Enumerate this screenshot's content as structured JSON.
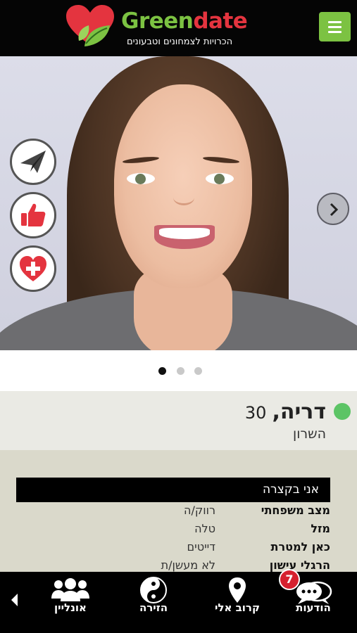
{
  "header": {
    "brand_part1": "Green",
    "brand_part2": "date",
    "tagline": "הכרויות לצמחונים וטבעונים",
    "menu_icon": "hamburger-icon"
  },
  "photo": {
    "actions": [
      {
        "icon": "paper-plane-icon"
      },
      {
        "icon": "thumbs-up-icon"
      },
      {
        "icon": "heart-plus-icon"
      }
    ],
    "next_icon": "chevron-right-icon",
    "dots_total": 3,
    "dots_active": 1
  },
  "profile": {
    "name": "דריה,",
    "age": "30",
    "location": "השרון",
    "online_color": "#5cc465"
  },
  "about": {
    "heading": "אני בקצרה",
    "rows": [
      {
        "label": "מצב משפחתי",
        "value": "רווק/ה"
      },
      {
        "label": "מזל",
        "value": "טלה"
      },
      {
        "label": "כאן למטרת",
        "value": "דייטים"
      },
      {
        "label": "הרגלי עישון",
        "value": "לא מעשן/ת"
      }
    ]
  },
  "nav": {
    "items": [
      {
        "label": "הודעות",
        "icon": "chat-bubbles-icon",
        "badge": "7"
      },
      {
        "label": "קרוב אלי",
        "icon": "map-pin-icon"
      },
      {
        "label": "הזירה",
        "icon": "yin-yang-icon"
      },
      {
        "label": "אונליין",
        "icon": "users-group-icon"
      }
    ],
    "scroll_icon": "chevron-left-icon"
  },
  "colors": {
    "brand_green": "#7cc242",
    "brand_red": "#e4343f",
    "badge_red": "#d6212f"
  }
}
